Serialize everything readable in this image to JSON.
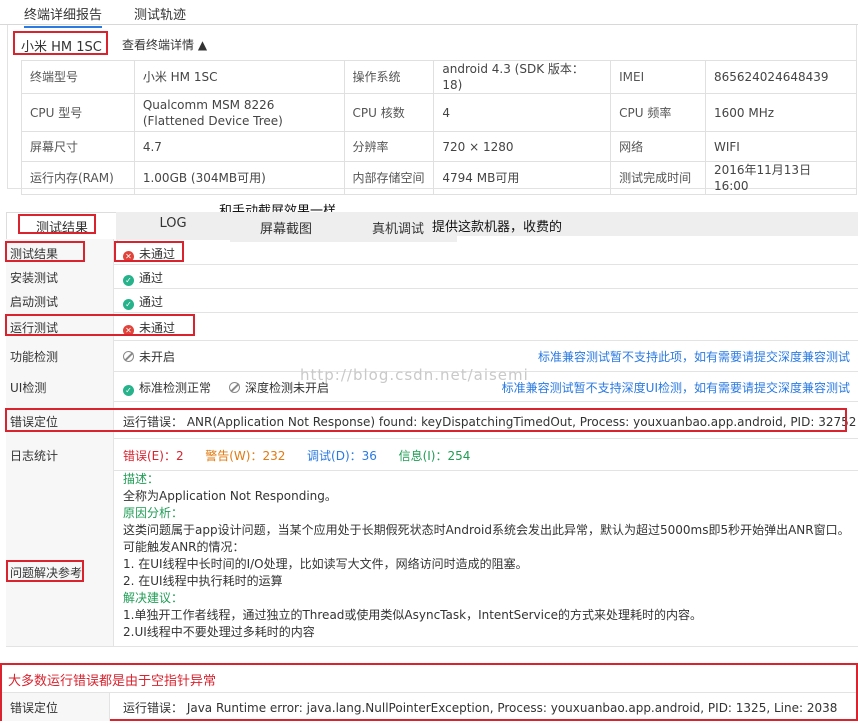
{
  "top_tabs": [
    "终端详细报告",
    "测试轨迹"
  ],
  "device": {
    "name": "小米 HM 1SC",
    "toggle": "查看终端详情 ▲",
    "specs": [
      [
        "终端型号",
        "小米 HM 1SC",
        "操作系统",
        "android 4.3 (SDK 版本：18)",
        "IMEI",
        "865624024648439"
      ],
      [
        "CPU 型号",
        "Qualcomm MSM 8226 (Flattened Device Tree)",
        "CPU 核数",
        "4",
        "CPU 频率",
        "1600 MHz"
      ],
      [
        "屏幕尺寸",
        "4.7",
        "分辨率",
        "720 × 1280",
        "网络",
        "WIFI"
      ],
      [
        "运行内存(RAM)",
        "1.00GB (304MB可用)",
        "内部存储空间",
        "4794 MB可用",
        "测试完成时间",
        "2016年11月13日 16:00"
      ]
    ]
  },
  "annotations": {
    "screenshot_note": "和手动截屏效果一样",
    "real_device_note": "提供这款机器，收费的",
    "null_pointer_note": "大多数运行错误都是由于空指针异常"
  },
  "result_tabs": [
    "测试结果",
    "LOG",
    "屏幕截图",
    "真机调试"
  ],
  "rows": {
    "result": {
      "label": "测试结果",
      "value": "未通过"
    },
    "install": {
      "label": "安装测试",
      "value": "通过"
    },
    "launch": {
      "label": "启动测试",
      "value": "通过"
    },
    "run": {
      "label": "运行测试",
      "value": "未通过"
    },
    "function": {
      "label": "功能检测",
      "value": "未开启",
      "link": "标准兼容测试暂不支持此项，如有需要请提交深度兼容测试"
    },
    "ui": {
      "label": "UI检测",
      "value1": "标准检测正常",
      "value2": "深度检测未开启",
      "link": "标准兼容测试暂不支持深度UI检测，如有需要请提交深度兼容测试"
    },
    "error": {
      "label": "错误定位",
      "value": "运行错误： ANR(Application Not Response) found: keyDispatchingTimedOut, Process: youxuanbao.app.android, PID: 32752"
    },
    "log": {
      "label": "日志统计",
      "errors": "错误(E)：2",
      "warnings": "警告(W)：232",
      "debug": "调试(D)：36",
      "info": "信息(I)：254"
    },
    "ref": {
      "label": "问题解决参考",
      "desc_title": "描述：",
      "desc": "全称为Application Not Responding。",
      "cause_title": "原因分析：",
      "cause1": "这类问题属于app设计问题，当某个应用处于长期假死状态时Android系统会发出此异常，默认为超过5000ms即5秒开始弹出ANR窗口。",
      "cause2": "可能触发ANR的情况：",
      "cause3": "1. 在UI线程中长时间的I/O处理，比如读写大文件，网络访问时造成的阻塞。",
      "cause4": "2. 在UI线程中执行耗时的运算",
      "advice_title": "解决建议：",
      "advice1": "1.单独开工作者线程，通过独立的Thread或使用类似AsyncTask，IntentService的方式来处理耗时的内容。",
      "advice2": "2.UI线程中不要处理过多耗时的内容"
    },
    "error2": {
      "label": "错误定位",
      "value": "运行错误： Java Runtime error: java.lang.NullPointerException, Process: youxuanbao.app.android, PID: 1325, Line: 2038"
    }
  },
  "watermark": "http://blog.csdn.net/aisemi",
  "colors": {
    "accent": "#2a7ae2",
    "annotation_red": "#d9232e",
    "pass": "#26b28a",
    "fail": "#e0443a"
  }
}
